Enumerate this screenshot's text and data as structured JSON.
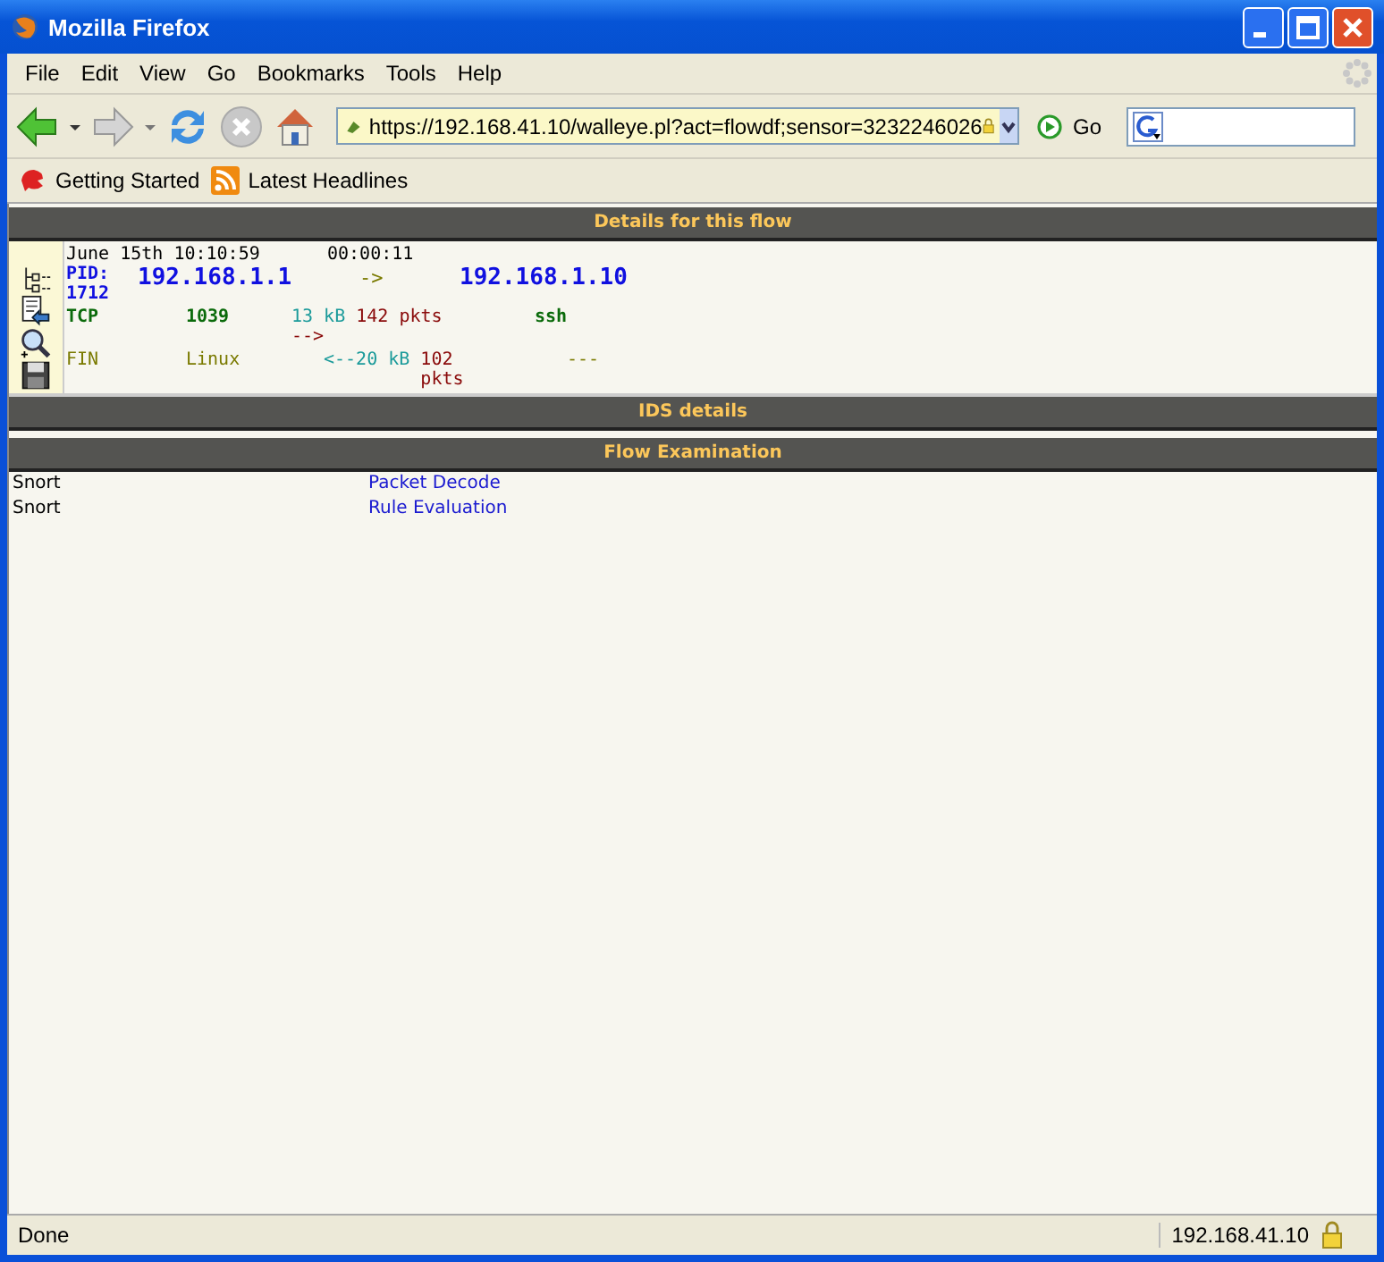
{
  "window": {
    "title": "Mozilla Firefox"
  },
  "menu": [
    "File",
    "Edit",
    "View",
    "Go",
    "Bookmarks",
    "Tools",
    "Help"
  ],
  "address": {
    "value": "https://192.168.41.10/walleye.pl?act=flowdf;sensor=3232246026"
  },
  "go_label": "Go",
  "bookmarks": [
    "Getting Started",
    "Latest Headlines"
  ],
  "details_header": "Details for this flow",
  "flow": {
    "start": "June 15th 10:10:59",
    "duration": "00:00:11",
    "pid": "PID: 1712",
    "src_ip": "192.168.1.1",
    "direction": "->",
    "dst_ip": "192.168.1.10",
    "protocol": "TCP",
    "src_port": "1039",
    "sent_bytes": "13 kB",
    "sent_packets": "142 pkts",
    "sent_arrow": "-->",
    "service": "ssh",
    "state": "FIN",
    "os": "Linux",
    "recv_bytes": "<--20 kB",
    "recv_packets": "102 pkts",
    "dst_port": "---"
  },
  "ids_header": "IDS details",
  "exam_header": "Flow Examination",
  "exam_rows": [
    {
      "tool": "Snort",
      "action": "Packet Decode"
    },
    {
      "tool": "Snort",
      "action": "Rule Evaluation"
    }
  ],
  "status_bar": {
    "text": "Done",
    "host": "192.168.41.10"
  }
}
